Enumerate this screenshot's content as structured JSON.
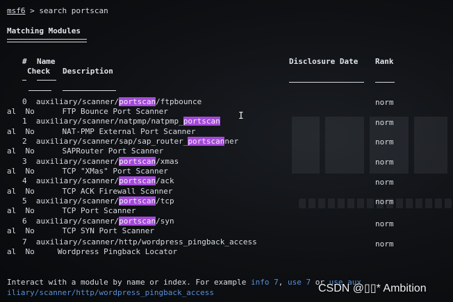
{
  "prompt": {
    "user": "msf6",
    "separator": " > ",
    "command": "search portscan"
  },
  "section_title": "Matching Modules",
  "columns": {
    "num": "#",
    "name": "Name",
    "check": "Check",
    "description": "Description",
    "disclosure_date": "Disclosure Date",
    "rank": "Rank"
  },
  "rows": [
    {
      "index": "0",
      "path_pre": "auxiliary/scanner/",
      "path_hl": "portscan",
      "path_post": "/ftpbounce",
      "wrap": "al",
      "check": "No",
      "description": "FTP Bounce Port Scanner",
      "rank": "norm"
    },
    {
      "index": "1",
      "path_pre": "auxiliary/scanner/natpmp/natpmp_",
      "path_hl": "portscan",
      "path_post": "",
      "wrap": "al",
      "check": "No",
      "description": "NAT-PMP External Port Scanner",
      "rank": "norm"
    },
    {
      "index": "2",
      "path_pre": "auxiliary/scanner/sap/sap_router_",
      "path_hl": "portscan",
      "path_post": "ner",
      "wrap": "al",
      "check": "No",
      "description": "SAPRouter Port Scanner",
      "rank": "norm"
    },
    {
      "index": "3",
      "path_pre": "auxiliary/scanner/",
      "path_hl": "portscan",
      "path_post": "/xmas",
      "wrap": "al",
      "check": "No",
      "description": "TCP \"XMas\" Port Scanner",
      "rank": "norm"
    },
    {
      "index": "4",
      "path_pre": "auxiliary/scanner/",
      "path_hl": "portscan",
      "path_post": "/ack",
      "wrap": "al",
      "check": "No",
      "description": "TCP ACK Firewall Scanner",
      "rank": "norm"
    },
    {
      "index": "5",
      "path_pre": "auxiliary/scanner/",
      "path_hl": "portscan",
      "path_post": "/tcp",
      "wrap": "al",
      "check": "No",
      "description": "TCP Port Scanner",
      "rank": "norm"
    },
    {
      "index": "6",
      "path_pre": "auxiliary/scanner/",
      "path_hl": "portscan",
      "path_post": "/syn",
      "wrap": "al",
      "check": "No",
      "description": "TCP SYN Port Scanner",
      "rank": "norm"
    },
    {
      "index": "7",
      "path_pre": "auxiliary/scanner/http/wordpress_pingback_access",
      "path_hl": "",
      "path_post": "",
      "wrap": "al",
      "check": "No",
      "description": "Wordpress Pingback Locator",
      "rank": "norm"
    }
  ],
  "footer": {
    "text": "Interact with a module by name or index. For example ",
    "info_cmd": "info 7",
    "sep": ", ",
    "use_cmd": "use 7",
    "or": " or ",
    "use_tail": "use aux",
    "line2": "iliary/scanner/http/wordpress_pingback_access"
  },
  "watermark": "CSDN @▯▯* Ambition",
  "colors": {
    "highlight": "#a44ad8",
    "command_blue": "#5a8fd6",
    "text": "#d8dce0",
    "background": "#0e1013"
  }
}
